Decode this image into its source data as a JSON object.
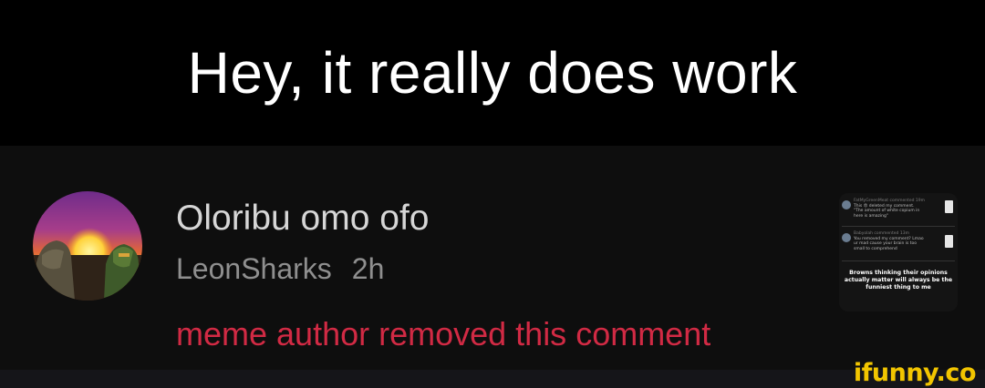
{
  "caption": {
    "text": "Hey, it really does work"
  },
  "notification": {
    "username": "Oloribu omo ofo",
    "author": "LeonSharks",
    "time": "2h",
    "status": "meme author removed this comment"
  },
  "thumbnail": {
    "comment1": {
      "header": "FatMyGreenMeat commented 19m",
      "lines": [
        "This 😡 deleted my comment.",
        "\"The amount of white copium in",
        "here is amazing\""
      ]
    },
    "comment2": {
      "header": "Babyolah commented 13m",
      "lines": [
        "You removed my comment? Lmao",
        "ur mad cause your brain is too",
        "small to comprehend"
      ]
    },
    "caption": [
      "Browns thinking their opinions",
      "actually matter will always be the",
      "funniest thing to me"
    ]
  },
  "watermark": "ifunny.co",
  "colors": {
    "caption_bg": "#000000",
    "card_bg": "#0e0e0e",
    "status_red": "#d12a44",
    "watermark_yellow": "#f2c500"
  }
}
